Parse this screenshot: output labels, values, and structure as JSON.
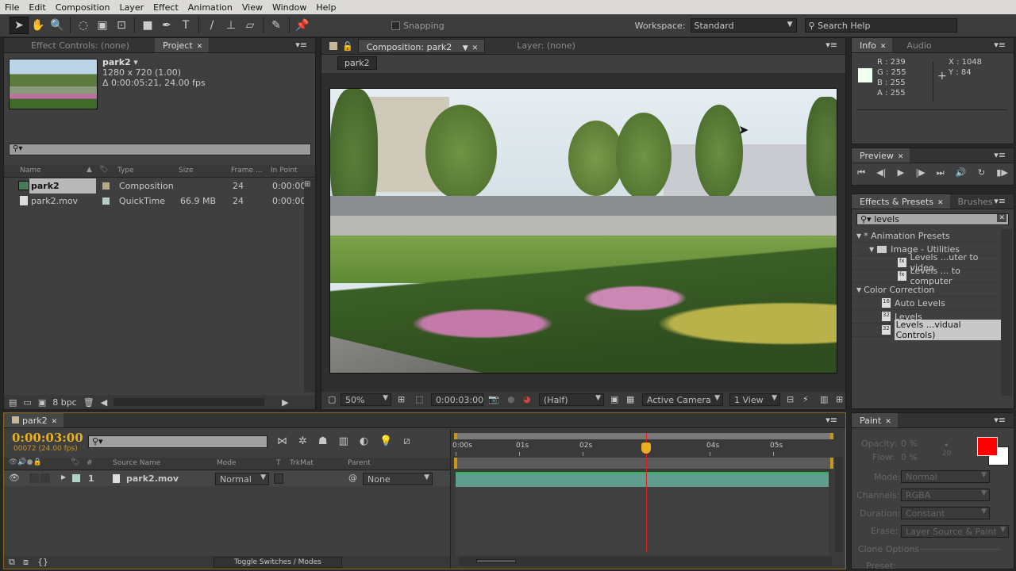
{
  "menu": [
    "File",
    "Edit",
    "Composition",
    "Layer",
    "Effect",
    "Animation",
    "View",
    "Window",
    "Help"
  ],
  "toolbar": {
    "snapping": "Snapping",
    "workspace_label": "Workspace:",
    "workspace": "Standard",
    "search_help": "Search Help"
  },
  "project_panel": {
    "tabs": [
      "Effect Controls: (none)",
      "Project"
    ],
    "item_name": "park2",
    "item_dims": "1280 x 720 (1.00)",
    "item_duration": "Δ 0:00:05:21, 24.00 fps",
    "columns": [
      "Name",
      "Type",
      "Size",
      "Frame ...",
      "In Point"
    ],
    "rows": [
      {
        "name": "park2",
        "type": "Composition",
        "size": "",
        "frame": "24",
        "in": "0:00:00",
        "label_color": "#b8a888"
      },
      {
        "name": "park2.mov",
        "type": "QuickTime",
        "size": "66.9 MB",
        "frame": "24",
        "in": "0:00:00",
        "label_color": "#b0d0c8"
      }
    ],
    "bpc": "8 bpc"
  },
  "comp_panel": {
    "tab": "Composition: park2",
    "layer_tab": "Layer: (none)",
    "crumb": "park2",
    "zoom": "50%",
    "time": "0:00:03:00",
    "resolution": "(Half)",
    "camera": "Active Camera",
    "views": "1 View"
  },
  "info": {
    "tabs": [
      "Info",
      "Audio"
    ],
    "r": "R : 239",
    "g": "G : 255",
    "b": "B : 255",
    "a": "A : 255",
    "x": "X : 1048",
    "y": "Y : 84",
    "swatch": "#effff f"
  },
  "preview": {
    "tab": "Preview"
  },
  "effects": {
    "tabs": [
      "Effects & Presets",
      "Brushes"
    ],
    "search": "levels",
    "tree": [
      {
        "label": "* Animation Presets",
        "level": 0,
        "kind": "group"
      },
      {
        "label": "Image - Utilities",
        "level": 1,
        "kind": "folder"
      },
      {
        "label": "Levels ...uter to video",
        "level": 2,
        "kind": "preset"
      },
      {
        "label": "Levels ... to computer",
        "level": 2,
        "kind": "preset"
      },
      {
        "label": "Color Correction",
        "level": 0,
        "kind": "group"
      },
      {
        "label": "Auto Levels",
        "level": 1,
        "kind": "effect",
        "bits": "16"
      },
      {
        "label": "Levels",
        "level": 1,
        "kind": "effect",
        "bits": "32"
      },
      {
        "label": "Levels ...vidual Controls)",
        "level": 1,
        "kind": "effect",
        "bits": "32",
        "selected": true
      }
    ]
  },
  "timeline": {
    "tab": "park2",
    "timecode": "0:00:03:00",
    "frames": "00072 (24.00 fps)",
    "columns": [
      "#",
      "Source Name",
      "Mode",
      "T",
      "TrkMat",
      "Parent"
    ],
    "layer": {
      "num": "1",
      "name": "park2.mov",
      "mode": "Normal",
      "parent": "None"
    },
    "ruler": [
      "0:00s",
      "01s",
      "02s",
      "03s",
      "04s",
      "05s"
    ],
    "current_time_s": 3,
    "duration_s": 5.875,
    "toggle": "Toggle Switches / Modes"
  },
  "paint": {
    "tab": "Paint",
    "opacity_label": "Opacity:",
    "opacity": "0 %",
    "flow_label": "Flow:",
    "flow": "0 %",
    "brush_size": "20",
    "mode_label": "Mode:",
    "mode": "Normal",
    "channels_label": "Channels:",
    "channels": "RGBA",
    "duration_label": "Duration:",
    "duration": "Constant",
    "erase_label": "Erase:",
    "erase": "Layer Source & Paint",
    "clone": "Clone Options",
    "preset_label": "Preset:",
    "fg": "#ff0000",
    "bg": "#ffffff"
  },
  "colors": {
    "accent": "#e8b020",
    "playhead": "#e02020",
    "layer_bar": "#5f9e8e"
  }
}
